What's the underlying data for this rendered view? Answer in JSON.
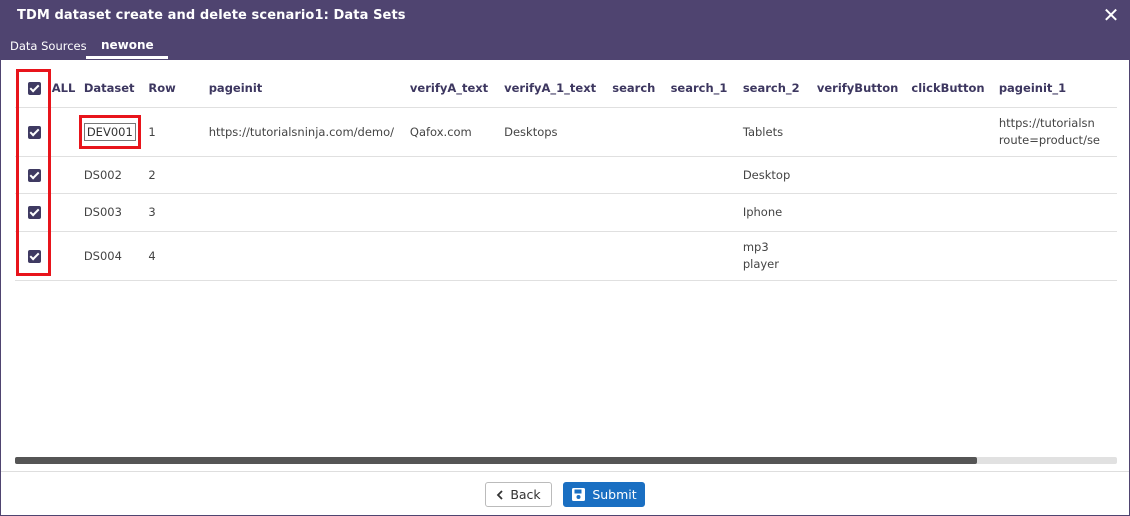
{
  "window": {
    "title": "TDM dataset create and delete scenario1: Data Sets",
    "close_glyph": "✕"
  },
  "tabs": [
    {
      "label": "Data Sources"
    },
    {
      "label": "newone",
      "active": true
    }
  ],
  "table": {
    "select_all_label": "ALL",
    "headers": [
      "Dataset",
      "Row",
      "pageinit",
      "verifyA_text",
      "verifyA_1_text",
      "search",
      "search_1",
      "search_2",
      "verifyButton",
      "clickButton",
      "pageinit_1"
    ],
    "rows": [
      {
        "checked": true,
        "dataset": "DEV001",
        "row": "1",
        "pageinit": "https://tutorialsninja.com/demo/",
        "verifyA_text": "Qafox.com",
        "verifyA_1_text": "Desktops",
        "search": "",
        "search_1": "",
        "search_2": "Tablets",
        "verifyButton": "",
        "clickButton": "",
        "pageinit_1_line1": "https://tutorialsn",
        "pageinit_1_line2": "route=product/se"
      },
      {
        "checked": true,
        "dataset": "DS002",
        "row": "2",
        "pageinit": "",
        "verifyA_text": "",
        "verifyA_1_text": "",
        "search": "",
        "search_1": "",
        "search_2": "Desktop",
        "verifyButton": "",
        "clickButton": "",
        "pageinit_1_line1": "",
        "pageinit_1_line2": ""
      },
      {
        "checked": true,
        "dataset": "DS003",
        "row": "3",
        "pageinit": "",
        "verifyA_text": "",
        "verifyA_1_text": "",
        "search": "",
        "search_1": "",
        "search_2": "Iphone",
        "verifyButton": "",
        "clickButton": "",
        "pageinit_1_line1": "",
        "pageinit_1_line2": ""
      },
      {
        "checked": true,
        "dataset": "DS004",
        "row": "4",
        "pageinit": "",
        "verifyA_text": "",
        "verifyA_1_text": "",
        "search": "",
        "search_1": "",
        "search_2_line1": "mp3",
        "search_2_line2": "player",
        "verifyButton": "",
        "clickButton": "",
        "pageinit_1_line1": "",
        "pageinit_1_line2": ""
      }
    ]
  },
  "scrollbar": {
    "horizontal_position_fraction": 0.87
  },
  "footer": {
    "back_label": "Back",
    "submit_label": "Submit"
  },
  "colors": {
    "header_bg": "#4f4470",
    "checkbox": "#3f3a62",
    "highlight": "#e8141b",
    "submit_bg": "#1a6fc2"
  }
}
